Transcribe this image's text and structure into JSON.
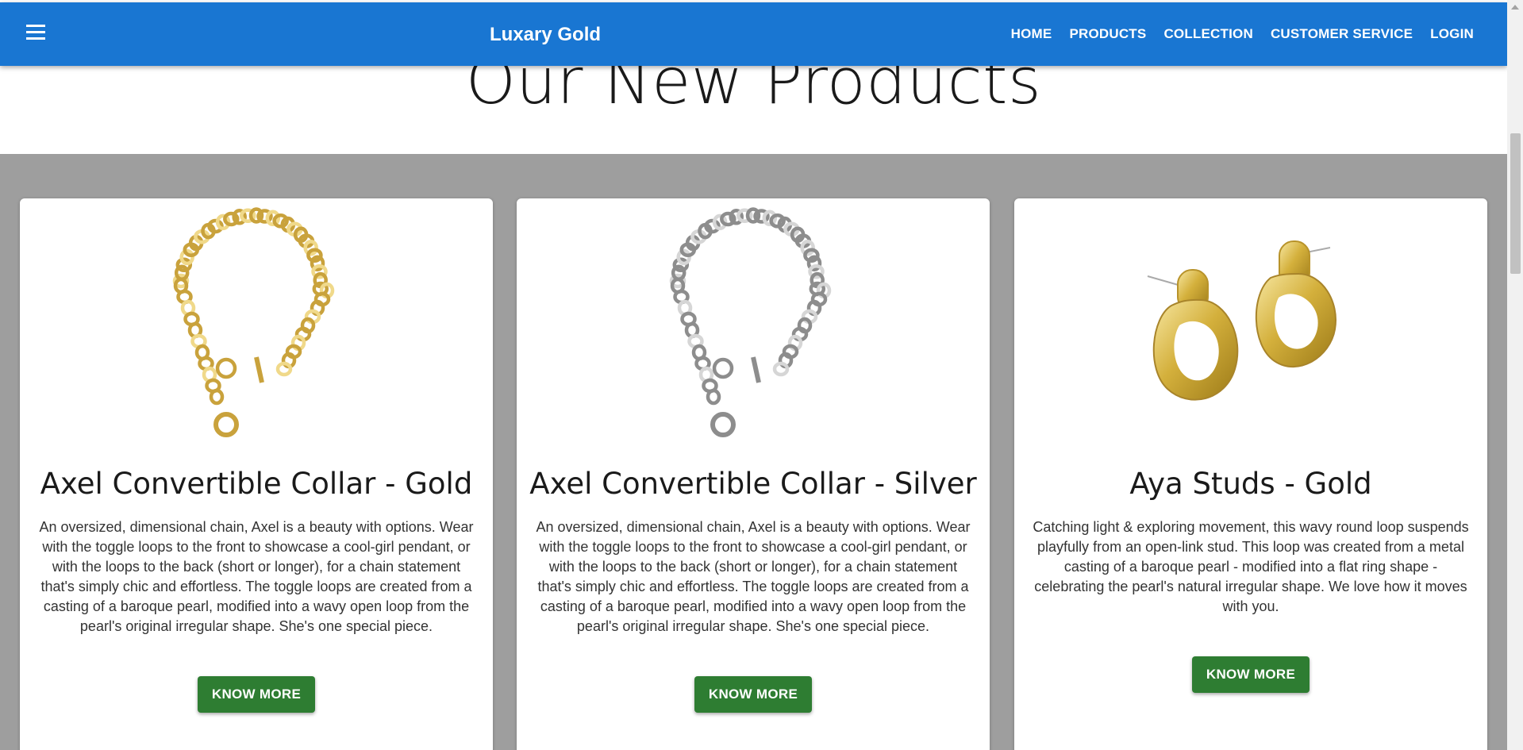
{
  "navbar": {
    "brand": "Luxary Gold",
    "links": [
      "HOME",
      "PRODUCTS",
      "COLLECTION",
      "CUSTOMER SERVICE",
      "LOGIN"
    ],
    "menu_icon": "hamburger-menu-icon",
    "background": "#1976d2"
  },
  "section": {
    "title": "Our New Products",
    "band_color": "#9e9e9e"
  },
  "products": [
    {
      "title": "Axel Convertible Collar - Gold",
      "image": "gold-chain-collar-image",
      "description": "An oversized, dimensional chain, Axel is a beauty with options. Wear with the toggle loops to the front to showcase a cool-girl pendant, or with the loops to the back (short or longer), for a chain statement that's simply chic and effortless. The toggle loops are created from a casting of a baroque pearl, modified into a wavy open loop from the pearl's original irregular shape. She's one special piece.",
      "button": "KNOW MORE"
    },
    {
      "title": "Axel Convertible Collar - Silver",
      "image": "silver-chain-collar-image",
      "description": "An oversized, dimensional chain, Axel is a beauty with options. Wear with the toggle loops to the front to showcase a cool-girl pendant, or with the loops to the back (short or longer), for a chain statement that's simply chic and effortless. The toggle loops are created from a casting of a baroque pearl, modified into a wavy open loop from the pearl's original irregular shape. She's one special piece.",
      "button": "KNOW MORE"
    },
    {
      "title": "Aya Studs - Gold",
      "image": "gold-loop-stud-earrings-image",
      "description": "Catching light & exploring movement, this wavy round loop suspends playfully from an open-link stud. This loop was created from a metal casting of a baroque pearl - modified into a flat ring shape - celebrating the pearl's natural irregular shape. We love how it moves with you.",
      "button": "KNOW MORE"
    }
  ],
  "colors": {
    "button_green": "#2e7d32"
  }
}
